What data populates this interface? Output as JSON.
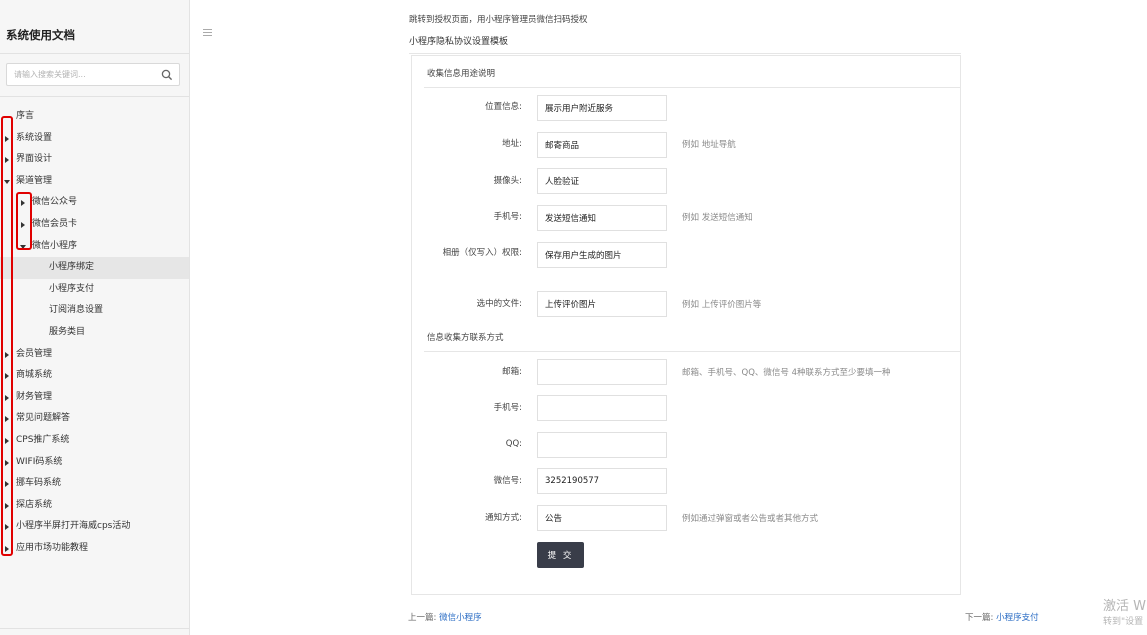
{
  "sidebar": {
    "title": "系统使用文档",
    "search_placeholder": "请输入搜索关键词...",
    "items": [
      {
        "label": "序言"
      },
      {
        "label": "系统设置"
      },
      {
        "label": "界面设计"
      },
      {
        "label": "渠道管理"
      },
      {
        "label": "微信公众号"
      },
      {
        "label": "微信会员卡"
      },
      {
        "label": "微信小程序"
      },
      {
        "label": "小程序绑定"
      },
      {
        "label": "小程序支付"
      },
      {
        "label": "订阅消息设置"
      },
      {
        "label": "服务类目"
      },
      {
        "label": "会员管理"
      },
      {
        "label": "商城系统"
      },
      {
        "label": "财务管理"
      },
      {
        "label": "常见问题解答"
      },
      {
        "label": "CPS推广系统"
      },
      {
        "label": "WIFI码系统"
      },
      {
        "label": "挪车码系统"
      },
      {
        "label": "探店系统"
      },
      {
        "label": "小程序半屏打开海威cps活动"
      },
      {
        "label": "应用市场功能教程"
      }
    ]
  },
  "main": {
    "top_text": "跳转到授权页面，用小程序管理员微信扫码授权",
    "section_title": "小程序隐私协议设置模板",
    "group1_title": "收集信息用途说明",
    "group2_title": "信息收集方联系方式",
    "fields": [
      {
        "label": "位置信息:",
        "value": "展示用户附近服务",
        "hint": ""
      },
      {
        "label": "地址:",
        "value": "邮寄商品",
        "hint": "例如 地址导航"
      },
      {
        "label": "摄像头:",
        "value": "人脸验证",
        "hint": ""
      },
      {
        "label": "手机号:",
        "value": "发送短信通知",
        "hint": "例如 发送短信通知"
      },
      {
        "label": "相册（仅写入）权限:",
        "value": "保存用户生成的图片",
        "hint": ""
      },
      {
        "label": "选中的文件:",
        "value": "上传评价图片",
        "hint": "例如 上传评价图片等"
      }
    ],
    "contacts": [
      {
        "label": "邮箱:",
        "value": "",
        "hint": "邮箱、手机号、QQ、微信号 4种联系方式至少要填一种"
      },
      {
        "label": "手机号:",
        "value": "",
        "hint": ""
      },
      {
        "label": "QQ:",
        "value": "",
        "hint": ""
      },
      {
        "label": "微信号:",
        "value": "3252190577",
        "hint": ""
      },
      {
        "label": "通知方式:",
        "value": "公告",
        "hint": "例如通过弹窗或者公告或者其他方式"
      }
    ],
    "submit_label": "提 交",
    "prev_label": "上一篇:",
    "prev_link": "微信小程序",
    "next_label": "下一篇:",
    "next_link": "小程序支付"
  },
  "watermark": {
    "line1": "激活 W",
    "line2": "转到\"设置"
  },
  "colors": {
    "accent_link": "#2a6cc4",
    "button_bg": "#393d49",
    "annotation_red": "#e00000"
  }
}
